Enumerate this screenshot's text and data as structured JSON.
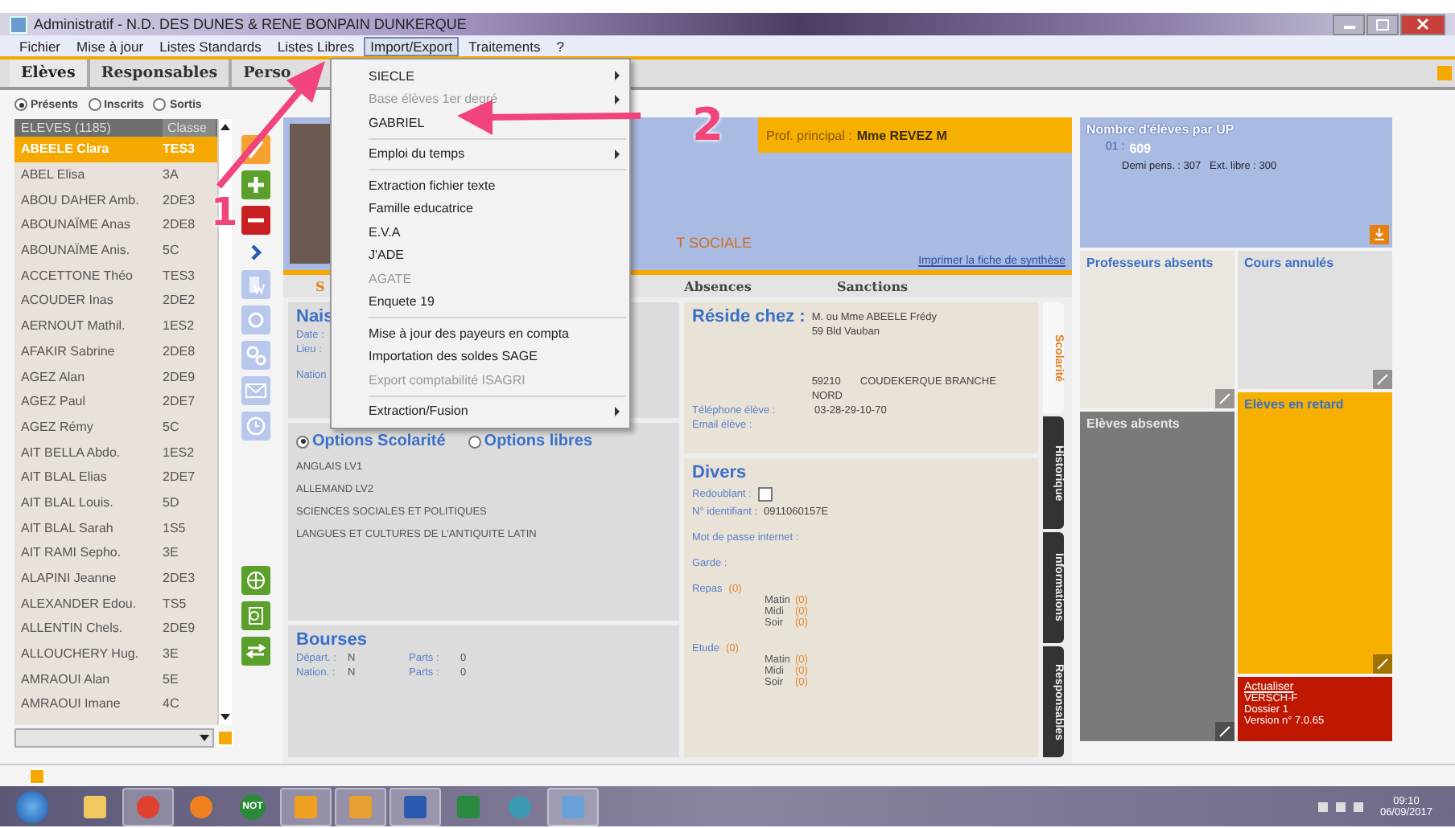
{
  "window": {
    "title": "Administratif - N.D. DES DUNES & RENE BONPAIN DUNKERQUE"
  },
  "menubar": [
    {
      "label": "Fichier",
      "selected": false
    },
    {
      "label": "Mise à jour",
      "selected": false
    },
    {
      "label": "Listes Standards",
      "selected": false
    },
    {
      "label": "Listes Libres",
      "selected": false
    },
    {
      "label": "Import/Export",
      "selected": true
    },
    {
      "label": "Traitements",
      "selected": false
    },
    {
      "label": "?",
      "selected": false
    }
  ],
  "tabs": [
    {
      "label": "Elèves",
      "selected": true
    },
    {
      "label": "Responsables",
      "selected": false
    },
    {
      "label": "Perso",
      "selected": false
    }
  ],
  "filter": [
    {
      "label": "Présents",
      "selected": true
    },
    {
      "label": "Inscrits",
      "selected": false
    },
    {
      "label": "Sortis",
      "selected": false
    }
  ],
  "students": {
    "columns": [
      "ELEVES (1185)",
      "Classe"
    ],
    "rows": [
      {
        "name": "ABEELE Clara",
        "class": "TES3",
        "selected": true
      },
      {
        "name": "ABEL Elisa",
        "class": "3A",
        "selected": false
      },
      {
        "name": "ABOU DAHER Amb.",
        "class": "2DE3",
        "selected": false
      },
      {
        "name": "ABOUNAÏME Anas",
        "class": "2DE8",
        "selected": false
      },
      {
        "name": "ABOUNAÏME Anis.",
        "class": "5C",
        "selected": false
      },
      {
        "name": "ACCETTONE Théo",
        "class": "TES3",
        "selected": false
      },
      {
        "name": "ACOUDER Inas",
        "class": "2DE2",
        "selected": false
      },
      {
        "name": "AERNOUT Mathil.",
        "class": "1ES2",
        "selected": false
      },
      {
        "name": "AFAKIR Sabrine",
        "class": "2DE8",
        "selected": false
      },
      {
        "name": "AGEZ Alan",
        "class": "2DE9",
        "selected": false
      },
      {
        "name": "AGEZ Paul",
        "class": "2DE7",
        "selected": false
      },
      {
        "name": "AGEZ Rémy",
        "class": "5C",
        "selected": false
      },
      {
        "name": "AIT BELLA Abdo.",
        "class": "1ES2",
        "selected": false
      },
      {
        "name": "AIT BLAL Elias",
        "class": "2DE7",
        "selected": false
      },
      {
        "name": "AIT BLAL Louis.",
        "class": "5D",
        "selected": false
      },
      {
        "name": "AIT BLAL Sarah",
        "class": "1S5",
        "selected": false
      },
      {
        "name": "AIT RAMI Sepho.",
        "class": "3E",
        "selected": false
      },
      {
        "name": "ALAPINI Jeanne",
        "class": "2DE3",
        "selected": false
      },
      {
        "name": "ALEXANDER Edou.",
        "class": "TS5",
        "selected": false
      },
      {
        "name": "ALLENTIN Chels.",
        "class": "2DE9",
        "selected": false
      },
      {
        "name": "ALLOUCHERY Hug.",
        "class": "3E",
        "selected": false
      },
      {
        "name": "AMRAOUI Alan",
        "class": "5E",
        "selected": false
      },
      {
        "name": "AMRAOUI Imane",
        "class": "4C",
        "selected": false
      }
    ]
  },
  "dropdown_menu": [
    {
      "label": "SIECLE",
      "disabled": false,
      "submenu": true,
      "separator_after": false
    },
    {
      "label": "Base élèves 1er degré",
      "disabled": true,
      "submenu": true,
      "separator_after": false
    },
    {
      "label": "GABRIEL",
      "disabled": false,
      "submenu": false,
      "separator_after": true
    },
    {
      "label": "Emploi du temps",
      "disabled": false,
      "submenu": true,
      "separator_after": true
    },
    {
      "label": "Extraction fichier texte",
      "disabled": false,
      "submenu": false,
      "separator_after": false
    },
    {
      "label": "Famille educatrice",
      "disabled": false,
      "submenu": false,
      "separator_after": false
    },
    {
      "label": "E.V.A",
      "disabled": false,
      "submenu": false,
      "separator_after": false
    },
    {
      "label": "J'ADE",
      "disabled": false,
      "submenu": false,
      "separator_after": false
    },
    {
      "label": "AGATE",
      "disabled": true,
      "submenu": false,
      "separator_after": false
    },
    {
      "label": "Enquete 19",
      "disabled": false,
      "submenu": false,
      "separator_after": true
    },
    {
      "label": "Mise à jour des payeurs en compta",
      "disabled": false,
      "submenu": false,
      "separator_after": false
    },
    {
      "label": "Importation des soldes SAGE",
      "disabled": false,
      "submenu": false,
      "separator_after": false
    },
    {
      "label": "Export comptabilité ISAGRI",
      "disabled": true,
      "submenu": false,
      "separator_after": true
    },
    {
      "label": "Extraction/Fusion",
      "disabled": false,
      "submenu": true,
      "separator_after": false
    }
  ],
  "header": {
    "prof_label": "Prof. principal :",
    "prof_name": "Mme REVEZ M",
    "section": "T SOCIALE",
    "print_link": "Imprimer la fiche de synthèse"
  },
  "detail_tabs": [
    {
      "label": "S",
      "selected": true
    },
    {
      "label": "Absences",
      "selected": false
    },
    {
      "label": "Sanctions",
      "selected": false
    }
  ],
  "birth": {
    "title": "Nais",
    "labels": [
      "Date :",
      "Lieu :",
      "Nation"
    ]
  },
  "options": {
    "modes": [
      {
        "label": "Options Scolarité",
        "selected": true
      },
      {
        "label": "Options libres",
        "selected": false
      }
    ],
    "items": [
      "ANGLAIS LV1",
      "ALLEMAND LV2",
      "SCIENCES SOCIALES ET POLITIQUES",
      "LANGUES ET CULTURES DE L'ANTIQUITE LATIN"
    ]
  },
  "bourses": {
    "title": "Bourses",
    "rows": [
      {
        "label": "Départ. :",
        "value": "N",
        "parts_label": "Parts :",
        "parts": "0"
      },
      {
        "label": "Nation. :",
        "value": "N",
        "parts_label": "Parts :",
        "parts": "0"
      }
    ]
  },
  "residence": {
    "title": "Réside chez :",
    "name": "M. ou Mme ABEELE Frédy",
    "street": "59 Bld Vauban",
    "postcode": "59210",
    "city": "COUDEKERQUE BRANCHE",
    "region": "NORD",
    "phone_label": "Téléphone élève :",
    "phone": "03-28-29-10-70",
    "email_label": "Email élève :"
  },
  "divers": {
    "title": "Divers",
    "redoublant_label": "Redoublant :",
    "redoublant": {
      "checked": false
    },
    "id_label": "N° identifiant :",
    "id": "0911060157E",
    "password_label": "Mot de passe internet :",
    "garde_label": "Garde :",
    "groups": [
      {
        "label": "Repas",
        "count": "(0)",
        "slots": [
          {
            "label": "Matin",
            "count": "(0)"
          },
          {
            "label": "Midi",
            "count": "(0)"
          },
          {
            "label": "Soir",
            "count": "(0)"
          }
        ]
      },
      {
        "label": "Etude",
        "count": "(0)",
        "slots": [
          {
            "label": "Matin",
            "count": "(0)"
          },
          {
            "label": "Midi",
            "count": "(0)"
          },
          {
            "label": "Soir",
            "count": "(0)"
          }
        ]
      }
    ]
  },
  "side_tabs": [
    {
      "label": "Scolarité",
      "selected": true
    },
    {
      "label": "Historique",
      "selected": false
    },
    {
      "label": "Informations",
      "selected": false
    },
    {
      "label": "Responsables",
      "selected": false
    }
  ],
  "dashboard": [
    {
      "kind": "summary",
      "title": "Nombre d'élèves par UP",
      "color": "#aabbe3",
      "up": "01 :",
      "count": "609",
      "detail": "Demi pens. : 307   Ext. libre : 300"
    },
    {
      "kind": "panel",
      "title": "Professeurs absents",
      "color": "#ebe6df"
    },
    {
      "kind": "panel",
      "title": "Cours annulés",
      "color": "#e0e0e0"
    },
    {
      "kind": "panel",
      "title": "Elèves en retard",
      "color": "#f8b000"
    },
    {
      "kind": "panel",
      "title": "Elèves absents",
      "color": "#7a7a7a"
    },
    {
      "kind": "info",
      "color": "#c01800",
      "link": "Actualiser",
      "lines": [
        "VERSCH-F",
        "Dossier 1",
        "Version n° 7.0.65"
      ]
    }
  ],
  "taskbar": {
    "apps": [
      {
        "kind": "folder",
        "open": false
      },
      {
        "kind": "chrome",
        "open": true
      },
      {
        "kind": "firefox",
        "open": false
      },
      {
        "kind": "note",
        "label": "NOT",
        "open": false
      },
      {
        "kind": "outlook",
        "open": true
      },
      {
        "kind": "pictures",
        "open": true
      },
      {
        "kind": "word",
        "open": true
      },
      {
        "kind": "excel",
        "open": false
      },
      {
        "kind": "network",
        "open": false
      },
      {
        "kind": "app",
        "open": true
      }
    ],
    "time": "09:10",
    "date": "06/09/2017"
  },
  "annotations": [
    {
      "label": "1"
    },
    {
      "label": "2"
    }
  ]
}
